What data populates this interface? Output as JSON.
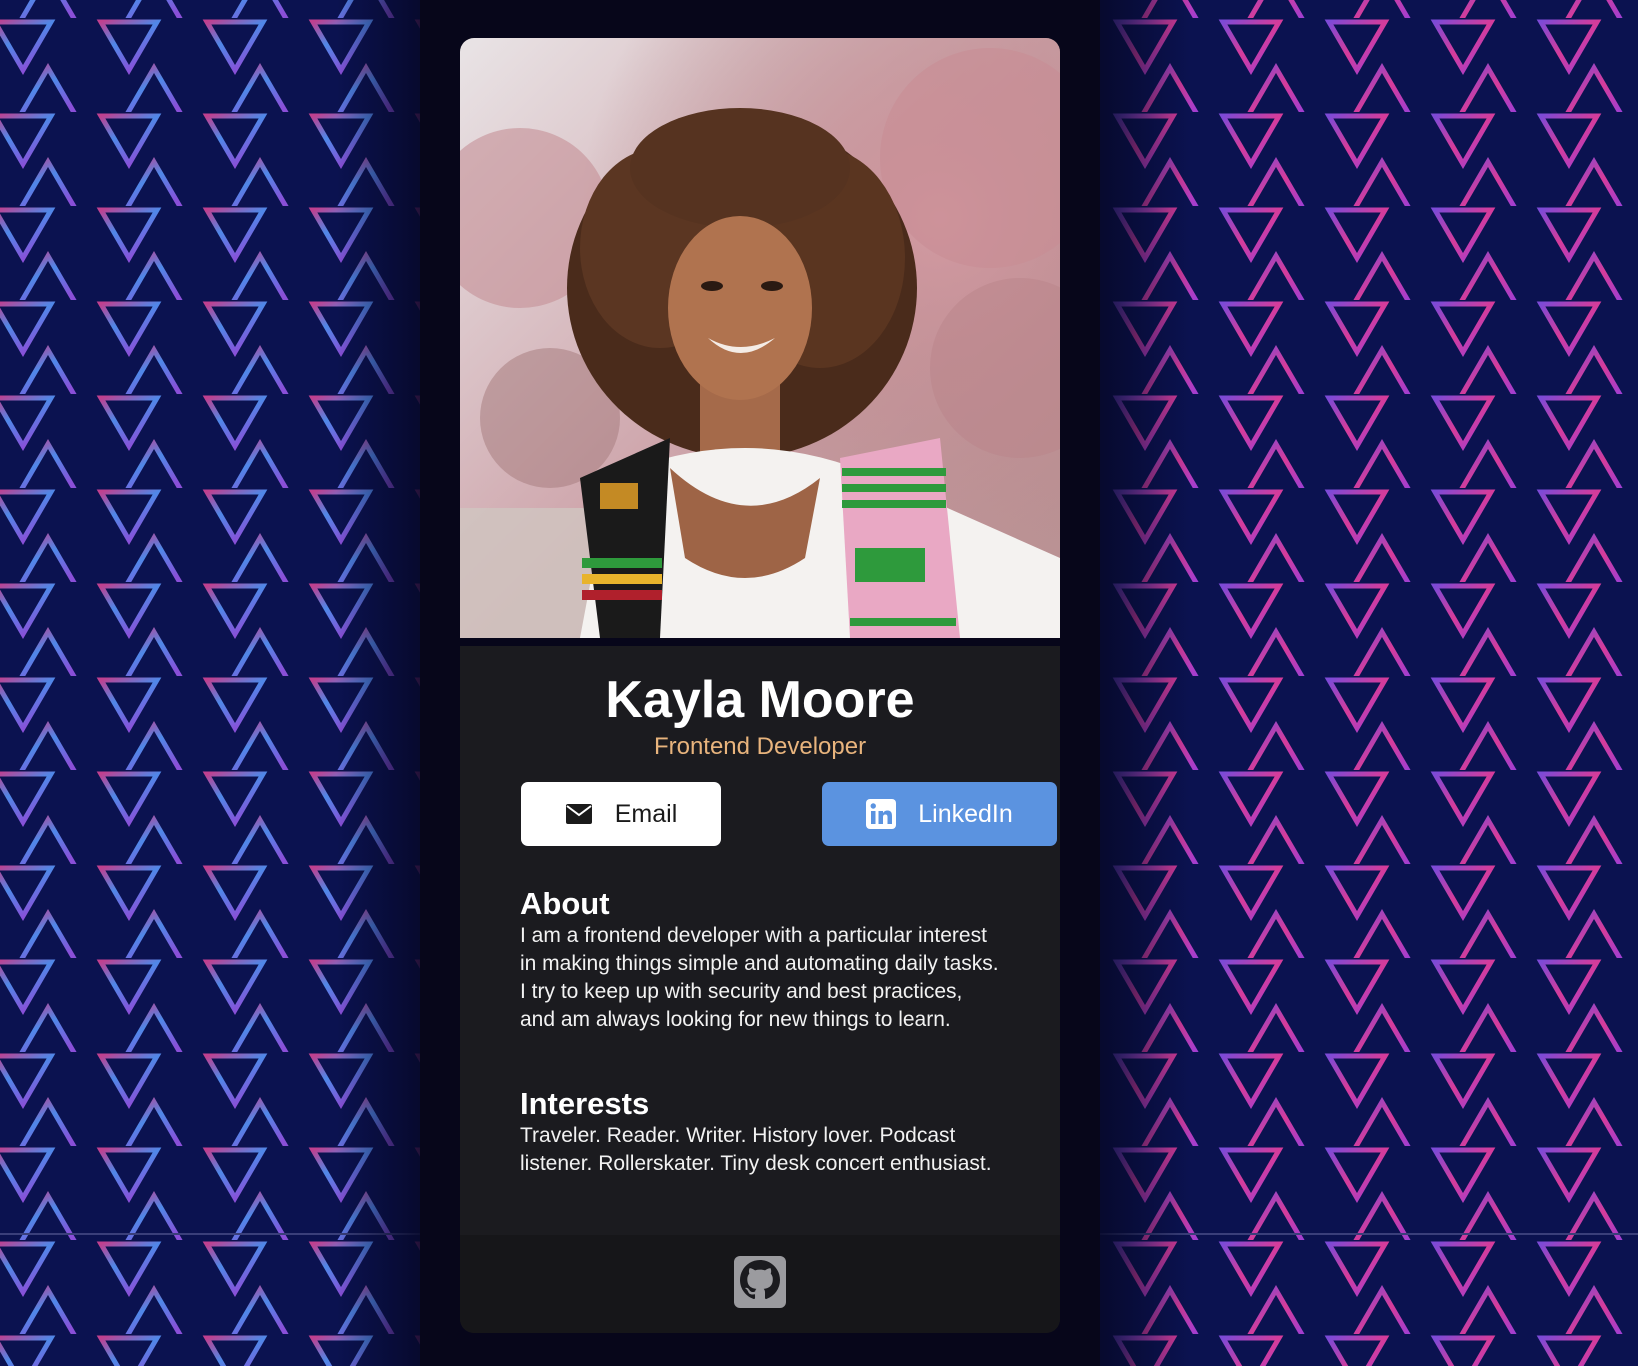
{
  "profile": {
    "name": "Kayla Moore",
    "role": "Frontend Developer"
  },
  "actions": {
    "email_label": "Email",
    "linkedin_label": "LinkedIn"
  },
  "about": {
    "heading": "About",
    "text": "I am a frontend developer with a particular interest in making things simple and automating daily tasks. I try to keep up with security and best practices, and am always looking for new things to learn."
  },
  "interests": {
    "heading": "Interests",
    "text": "Traveler. Reader. Writer. History lover. Podcast listener. Rollerskater. Tiny desk concert enthusiast."
  },
  "footer": {
    "icons": [
      "github-icon"
    ]
  },
  "colors": {
    "card_bg": "#1b1b1f",
    "role_color": "#e8b47d",
    "linkedin_button": "#5b93e0",
    "email_button": "#ffffff",
    "page_bg": "#0b1250"
  },
  "icons": {
    "email": "envelope-icon",
    "linkedin": "linkedin-icon",
    "github": "github-icon"
  }
}
